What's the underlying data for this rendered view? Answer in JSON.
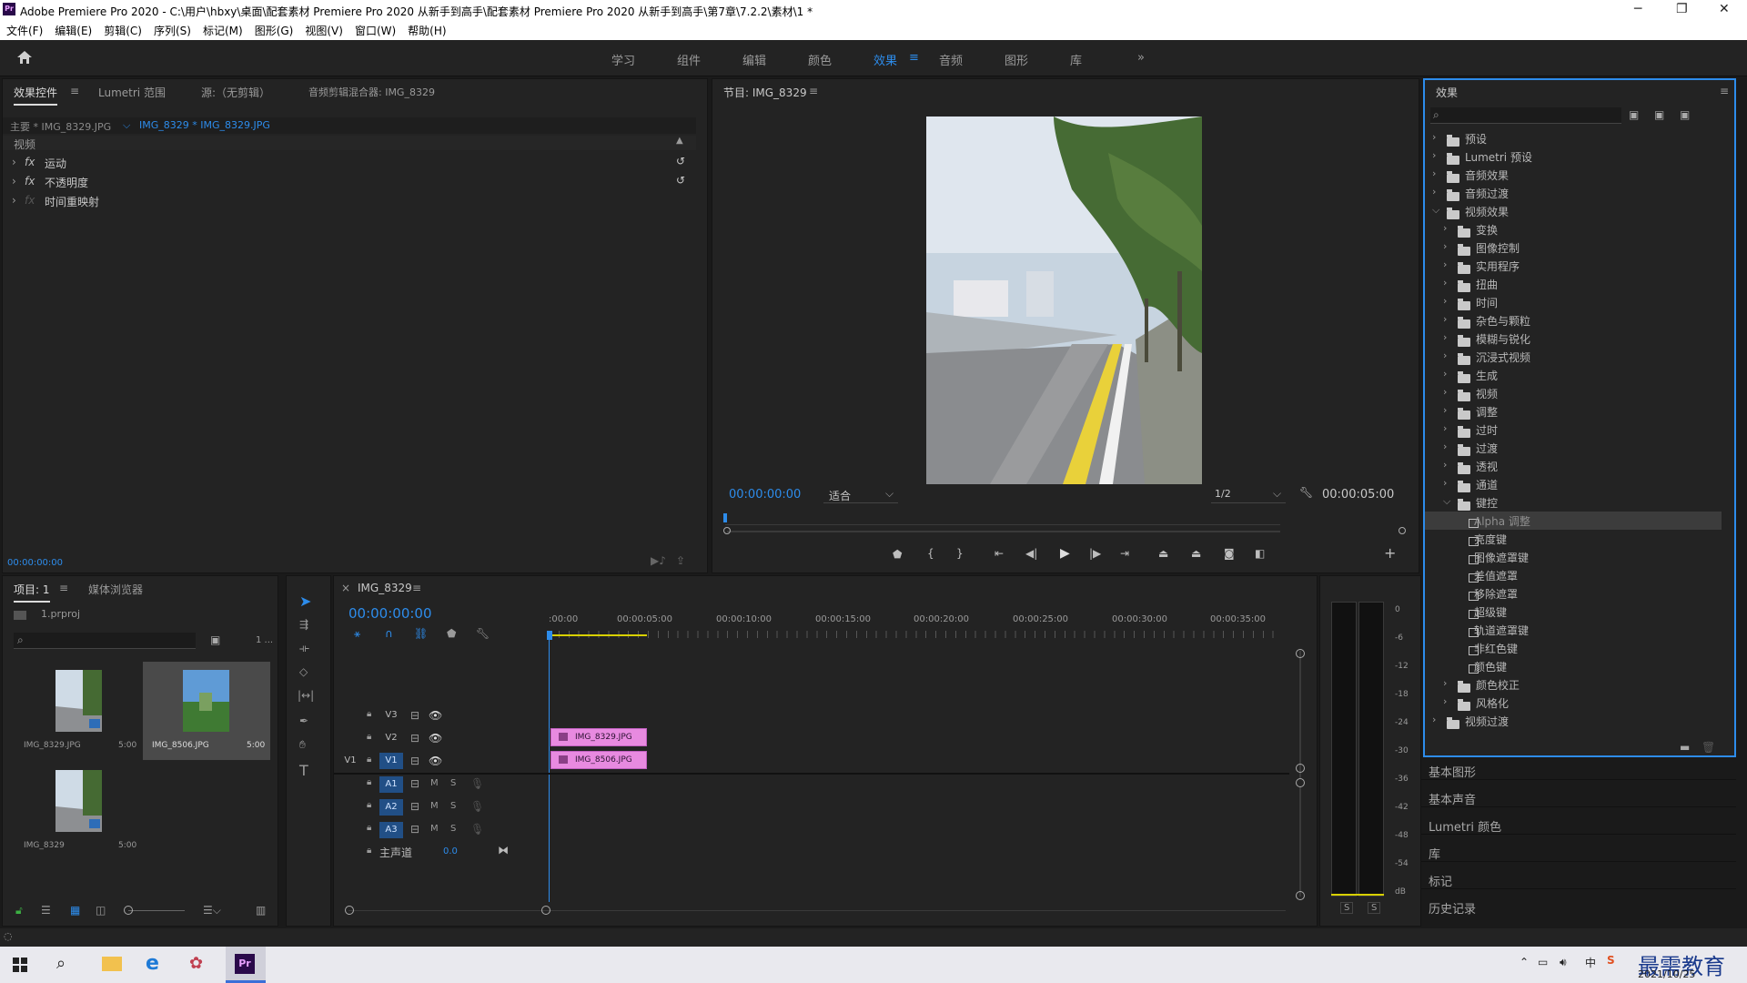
{
  "titlebar": {
    "title": "Adobe Premiere Pro 2020 - C:\\用户\\hbxy\\桌面\\配套素材 Premiere Pro 2020 从新手到高手\\配套素材 Premiere Pro 2020 从新手到高手\\第7章\\7.2.2\\素材\\1 *",
    "minimize": "─",
    "maximize": "❐",
    "close": "✕"
  },
  "menu": [
    "文件(F)",
    "编辑(E)",
    "剪辑(C)",
    "序列(S)",
    "标记(M)",
    "图形(G)",
    "视图(V)",
    "窗口(W)",
    "帮助(H)"
  ],
  "workspace_tabs": [
    "学习",
    "组件",
    "编辑",
    "颜色",
    "效果",
    "音频",
    "图形",
    "库"
  ],
  "workspace_active": "效果",
  "workspace_more": "»",
  "effect_controls": {
    "tabs": [
      "效果控件",
      "Lumetri 范围",
      "源:（无剪辑）",
      "音频剪辑混合器: IMG_8329"
    ],
    "menu_icon": "≡",
    "master": "主要 * IMG_8329.JPG",
    "sequence": "IMG_8329 * IMG_8329.JPG",
    "section": "视频",
    "rows": [
      "运动",
      "不透明度",
      "时间重映射"
    ],
    "fx": "fx",
    "timecode": "00:00:00:00"
  },
  "program": {
    "title": "节目: IMG_8329",
    "timecode_left": "00:00:00:00",
    "fit": "适合",
    "quality": "1/2",
    "timecode_right": "00:00:05:00"
  },
  "project": {
    "tabs": [
      "项目: 1",
      "媒体浏览器"
    ],
    "file": "1.prproj",
    "count": "1 ...",
    "items": [
      {
        "name": "IMG_8329.JPG",
        "dur": "5:00"
      },
      {
        "name": "IMG_8506.JPG",
        "dur": "5:00"
      },
      {
        "name": "IMG_8329",
        "dur": "5:00"
      }
    ]
  },
  "timeline": {
    "close": "×",
    "name": "IMG_8329",
    "menu": "≡",
    "timecode": "00:00:00:00",
    "ruler": [
      ":00:00",
      "00:00:05:00",
      "00:00:10:00",
      "00:00:15:00",
      "00:00:20:00",
      "00:00:25:00",
      "00:00:30:00",
      "00:00:35:00"
    ],
    "video_tracks": [
      "V3",
      "V2",
      "V1"
    ],
    "src_v1": "V1",
    "audio_tracks": [
      "A1",
      "A2",
      "A3"
    ],
    "mute": "M",
    "solo": "S",
    "master_label": "主声道",
    "master_value": "0.0",
    "clips": [
      {
        "track": "V2",
        "name": "IMG_8329.JPG"
      },
      {
        "track": "V1",
        "name": "IMG_8506.JPG"
      }
    ]
  },
  "meter": {
    "ticks": [
      "0",
      "-6",
      "-12",
      "-18",
      "-24",
      "-30",
      "-36",
      "-42",
      "-48",
      "-54",
      "dB"
    ],
    "solo": [
      "S",
      "S"
    ]
  },
  "effects": {
    "title": "效果",
    "menu": "≡",
    "tree": [
      {
        "label": "预设",
        "level": 0,
        "open": false
      },
      {
        "label": "Lumetri 预设",
        "level": 0,
        "open": false
      },
      {
        "label": "音频效果",
        "level": 0,
        "open": false
      },
      {
        "label": "音频过渡",
        "level": 0,
        "open": false
      },
      {
        "label": "视频效果",
        "level": 0,
        "open": true
      },
      {
        "label": "变换",
        "level": 1,
        "open": false
      },
      {
        "label": "图像控制",
        "level": 1,
        "open": false
      },
      {
        "label": "实用程序",
        "level": 1,
        "open": false
      },
      {
        "label": "扭曲",
        "level": 1,
        "open": false
      },
      {
        "label": "时间",
        "level": 1,
        "open": false
      },
      {
        "label": "杂色与颗粒",
        "level": 1,
        "open": false
      },
      {
        "label": "模糊与锐化",
        "level": 1,
        "open": false
      },
      {
        "label": "沉浸式视频",
        "level": 1,
        "open": false
      },
      {
        "label": "生成",
        "level": 1,
        "open": false
      },
      {
        "label": "视频",
        "level": 1,
        "open": false
      },
      {
        "label": "调整",
        "level": 1,
        "open": false
      },
      {
        "label": "过时",
        "level": 1,
        "open": false
      },
      {
        "label": "过渡",
        "level": 1,
        "open": false
      },
      {
        "label": "透视",
        "level": 1,
        "open": false
      },
      {
        "label": "通道",
        "level": 1,
        "open": false
      },
      {
        "label": "键控",
        "level": 1,
        "open": true
      },
      {
        "label": "Alpha 调整",
        "level": 2,
        "selected": true
      },
      {
        "label": "亮度键",
        "level": 2
      },
      {
        "label": "图像遮罩键",
        "level": 2
      },
      {
        "label": "差值遮罩",
        "level": 2
      },
      {
        "label": "移除遮罩",
        "level": 2
      },
      {
        "label": "超级键",
        "level": 2
      },
      {
        "label": "轨道遮罩键",
        "level": 2
      },
      {
        "label": "非红色键",
        "level": 2
      },
      {
        "label": "颜色键",
        "level": 2
      },
      {
        "label": "颜色校正",
        "level": 1,
        "open": false
      },
      {
        "label": "风格化",
        "level": 1,
        "open": false
      },
      {
        "label": "视频过渡",
        "level": 0,
        "open": false
      }
    ],
    "sections": [
      "基本图形",
      "基本声音",
      "Lumetri 颜色",
      "库",
      "标记",
      "历史记录"
    ]
  },
  "taskbar": {
    "date": "2021/10/25",
    "watermark": "最需教育",
    "ime": "中"
  }
}
